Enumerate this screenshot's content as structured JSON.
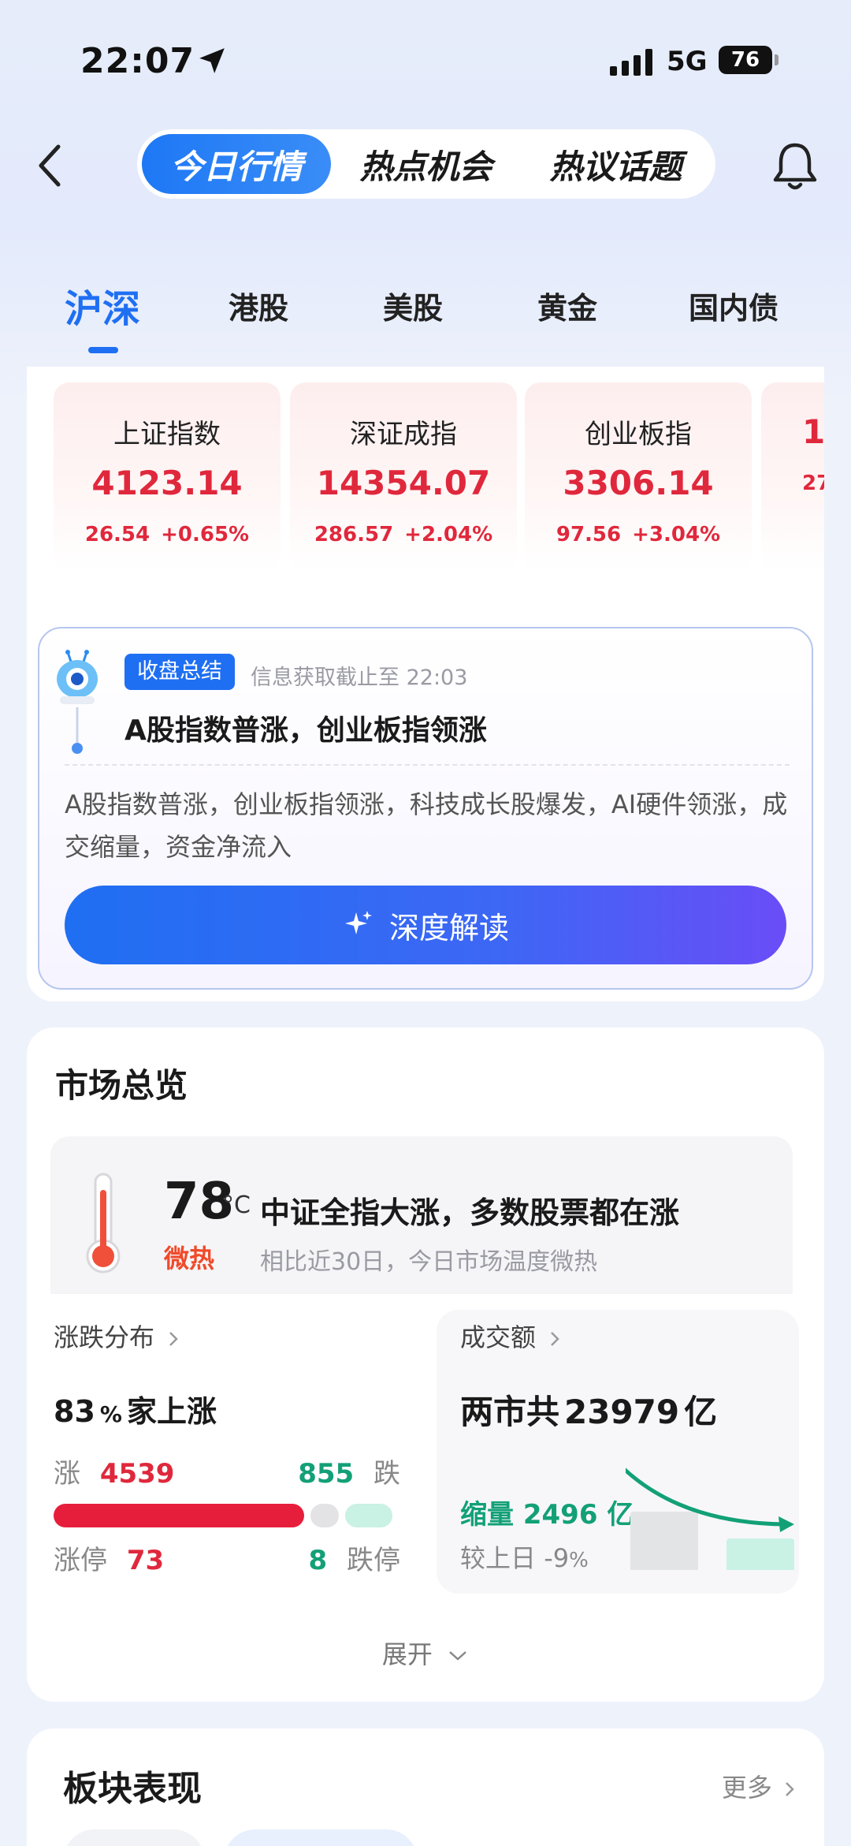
{
  "status": {
    "time": "22:07",
    "network": "5G",
    "battery": "76"
  },
  "nav": {
    "segments": [
      "今日行情",
      "热点机会",
      "热议话题"
    ]
  },
  "market_tabs": [
    "沪深",
    "港股",
    "美股",
    "黄金",
    "国内债"
  ],
  "indices": [
    {
      "name": "上证指数",
      "price": "4123.14",
      "change": "26.54",
      "pct": "+0.65%"
    },
    {
      "name": "深证成指",
      "price": "14354.07",
      "change": "286.57",
      "pct": "+2.04%"
    },
    {
      "name": "创业板指",
      "price": "3306.14",
      "change": "97.56",
      "pct": "+3.04%"
    },
    {
      "name": "",
      "price": "1",
      "change": "27",
      "pct": ""
    }
  ],
  "summary": {
    "badge": "收盘总结",
    "time": "信息获取截止至 22:03",
    "title": "A股指数普涨，创业板指领涨",
    "body": "A股指数普涨，创业板指领涨，科技成长股爆发，AI硬件领涨，成交缩量，资金净流入",
    "button": "深度解读"
  },
  "overview": {
    "title": "市场总览",
    "temp_value": "78",
    "temp_unit": "°C",
    "temp_headline": "中证全指大涨，多数股票都在涨",
    "temp_level": "微热",
    "temp_sub": "相比近30日，今日市场温度微热",
    "rise": {
      "header": "涨跌分布",
      "pct": "83",
      "pct_suffix": "%",
      "text": "家上涨",
      "up_label": "涨",
      "up_count": "4539",
      "down_label": "跌",
      "down_count": "855",
      "limit_up_label": "涨停",
      "limit_up": "73",
      "limit_down_label": "跌停",
      "limit_down": "8",
      "up_fraction": 0.84
    },
    "volume": {
      "header": "成交额",
      "prefix": "两市共",
      "amount": "23979",
      "unit": "亿",
      "shrink_label": "缩量",
      "shrink_amount": "2496",
      "shrink_unit": "亿",
      "compare_label": "较上日",
      "compare_value": "-9",
      "compare_unit": "%"
    },
    "expand": "展开"
  },
  "sectors": {
    "title": "板块表现",
    "more": "更多"
  },
  "colors": {
    "accent": "#1f6ff2",
    "up": "#e0283c",
    "down": "#13a077",
    "warm": "#f04a2a"
  }
}
